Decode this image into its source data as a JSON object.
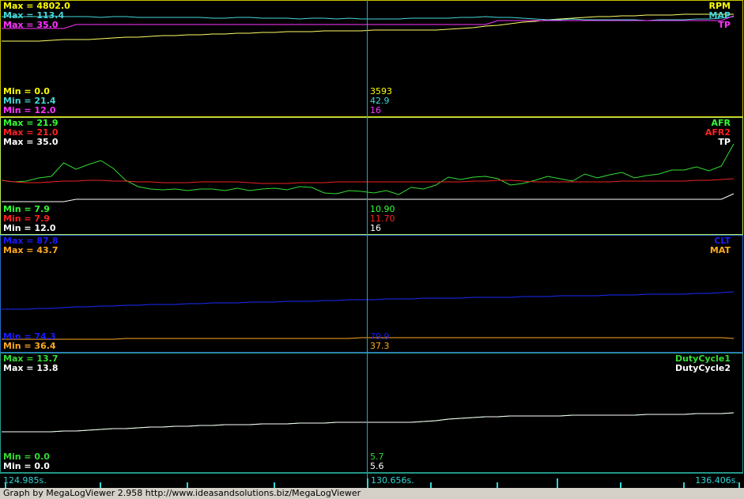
{
  "colors": {
    "background": "#000000",
    "cursor": "#2aa6b8",
    "axis": "#1a8c7c",
    "axis_text": "#2fd6d6",
    "footer_bg": "#d4d0c8"
  },
  "chart_data": [
    {
      "type": "line",
      "panel_border_color": "#c8c200",
      "x": [
        124.985,
        136.406
      ],
      "series": [
        {
          "name": "RPM",
          "color": "#ffff66",
          "legend_color": "#ffff00",
          "max": "Max = 4802.0",
          "min": "Min = 0.0",
          "cursor_value": "3593",
          "values": [
            52,
            52,
            52,
            52,
            51,
            50,
            50,
            50,
            49,
            48,
            47,
            47,
            46,
            45,
            45,
            44,
            44,
            43,
            43,
            42,
            42,
            41,
            41,
            40,
            40,
            40,
            39,
            39,
            39,
            39,
            38,
            38,
            38,
            38,
            38,
            38,
            37,
            36,
            35,
            33,
            32,
            30,
            28,
            27,
            25,
            24,
            23,
            22,
            21,
            21,
            20,
            20,
            19,
            19,
            19,
            18,
            18,
            18,
            18,
            18
          ]
        },
        {
          "name": "MAP",
          "color": "#44d8d8",
          "legend_color": "#44d8d8",
          "max": "Max = 113.4",
          "min": "Min = 21.4",
          "cursor_value": "42.9",
          "values": [
            21,
            21,
            21,
            21,
            20,
            21,
            21,
            21,
            22,
            21,
            21,
            22,
            22,
            22,
            22,
            22,
            22,
            23,
            23,
            22,
            22,
            23,
            23,
            23,
            24,
            23,
            23,
            24,
            23,
            24,
            24,
            24,
            24,
            23,
            23,
            23,
            23,
            22,
            22,
            21,
            22,
            22,
            23,
            24,
            25,
            25,
            24,
            25,
            25,
            25,
            25,
            25,
            26,
            25,
            25,
            25,
            24,
            24,
            23,
            21
          ]
        },
        {
          "name": "TP",
          "color": "#ff33ff",
          "legend_color": "#ff33ff",
          "max": "Max = 35.0",
          "min": "Min = 12.0",
          "cursor_value": "16",
          "values": [
            36,
            36,
            36,
            36,
            36,
            36,
            31,
            31,
            31,
            31,
            31,
            31,
            31,
            31,
            31,
            31,
            31,
            31,
            31,
            31,
            31,
            31,
            31,
            31,
            31,
            31,
            31,
            31,
            31,
            31,
            31,
            31,
            31,
            31,
            31,
            31,
            31,
            31,
            31,
            31,
            26,
            26,
            26,
            26,
            26,
            26,
            26,
            26,
            26,
            26,
            26,
            26,
            26,
            26,
            26,
            26,
            26,
            26,
            26,
            20
          ]
        }
      ]
    },
    {
      "type": "line",
      "panel_border_color": "#b8e860",
      "x": [
        124.985,
        136.406
      ],
      "series": [
        {
          "name": "AFR",
          "color": "#33dd33",
          "legend_color": "#33ff33",
          "max": "Max = 21.9",
          "min": "Min = 7.9",
          "cursor_value": "10.90",
          "values": [
            80,
            82,
            81,
            77,
            75,
            58,
            66,
            60,
            55,
            65,
            80,
            88,
            91,
            92,
            91,
            93,
            91,
            91,
            93,
            90,
            93,
            91,
            90,
            92,
            88,
            89,
            96,
            97,
            93,
            94,
            96,
            93,
            98,
            89,
            91,
            86,
            76,
            79,
            76,
            75,
            78,
            86,
            84,
            80,
            75,
            78,
            81,
            72,
            77,
            73,
            70,
            77,
            74,
            72,
            67,
            67,
            63,
            68,
            62,
            34
          ]
        },
        {
          "name": "AFR2",
          "color": "#ee2222",
          "legend_color": "#ff2222",
          "max": "Max = 21.0",
          "min": "Min = 7.9",
          "cursor_value": "11.70",
          "values": [
            80,
            82,
            83,
            83,
            82,
            81,
            81,
            80,
            80,
            81,
            81,
            82,
            82,
            83,
            83,
            83,
            82,
            82,
            82,
            82,
            83,
            84,
            84,
            84,
            83,
            83,
            83,
            82,
            82,
            82,
            82,
            82,
            82,
            82,
            82,
            82,
            82,
            82,
            81,
            81,
            80,
            80,
            81,
            82,
            82,
            82,
            82,
            82,
            82,
            82,
            81,
            81,
            81,
            81,
            81,
            81,
            80,
            80,
            79,
            78
          ]
        },
        {
          "name": "TP",
          "color": "#ffffff",
          "legend_color": "#ffffff",
          "max": "Max = 35.0",
          "min": "Min = 12.0",
          "cursor_value": "16",
          "values": [
            107,
            107,
            107,
            107,
            107,
            107,
            104,
            104,
            104,
            104,
            104,
            104,
            104,
            104,
            104,
            104,
            104,
            104,
            104,
            104,
            104,
            104,
            104,
            104,
            104,
            104,
            104,
            104,
            104,
            104,
            104,
            104,
            104,
            104,
            104,
            104,
            104,
            104,
            104,
            104,
            104,
            104,
            104,
            104,
            104,
            104,
            104,
            104,
            104,
            104,
            104,
            104,
            104,
            104,
            104,
            104,
            104,
            104,
            104,
            97
          ]
        }
      ]
    },
    {
      "type": "line",
      "panel_border_color": "#2a6ec8",
      "x": [
        124.985,
        136.406
      ],
      "series": [
        {
          "name": "CLT",
          "color": "#1a2bff",
          "legend_color": "#1a1aff",
          "max": "Max = 87.8",
          "min": "Min = 74.3",
          "cursor_value": "79.9",
          "values": [
            94,
            94,
            94,
            93,
            93,
            92,
            91,
            91,
            90,
            90,
            89,
            89,
            88,
            88,
            88,
            87,
            87,
            86,
            86,
            86,
            85,
            85,
            85,
            84,
            84,
            84,
            83,
            83,
            82,
            82,
            82,
            81,
            81,
            81,
            80,
            80,
            80,
            80,
            79,
            79,
            79,
            79,
            78,
            78,
            78,
            77,
            77,
            77,
            77,
            76,
            76,
            76,
            75,
            75,
            75,
            75,
            74,
            74,
            73,
            72
          ]
        },
        {
          "name": "MAT",
          "color": "#ffaa22",
          "legend_color": "#ffaa22",
          "max": "Max = 43.7",
          "min": "Min = 36.4",
          "cursor_value": "37.3",
          "values": [
            132,
            132,
            132,
            132,
            132,
            132,
            132,
            132,
            132,
            132,
            131,
            131,
            131,
            131,
            131,
            131,
            131,
            131,
            131,
            131,
            131,
            131,
            131,
            131,
            131,
            131,
            131,
            131,
            131,
            130,
            130,
            130,
            130,
            130,
            130,
            130,
            130,
            130,
            130,
            130,
            130,
            130,
            130,
            130,
            130,
            130,
            130,
            130,
            130,
            130,
            130,
            130,
            130,
            130,
            130,
            130,
            130,
            130,
            130,
            131
          ]
        }
      ]
    },
    {
      "type": "line",
      "panel_border_color": "#2a9c8c",
      "x": [
        124.985,
        136.406
      ],
      "series": [
        {
          "name": "DutyCycle1",
          "color": "#33cc33",
          "legend_color": "#33dd33",
          "max": "Max = 13.7",
          "min": "Min = 0.0",
          "cursor_value": "5.7",
          "values": [
            100,
            100,
            100,
            100,
            100,
            99,
            99,
            98,
            97,
            96,
            96,
            95,
            94,
            94,
            93,
            93,
            92,
            92,
            91,
            91,
            91,
            90,
            90,
            90,
            89,
            89,
            89,
            88,
            88,
            88,
            88,
            88,
            88,
            88,
            87,
            86,
            84,
            83,
            82,
            81,
            81,
            80,
            80,
            80,
            80,
            80,
            79,
            79,
            79,
            79,
            79,
            79,
            78,
            78,
            78,
            78,
            77,
            77,
            77,
            76
          ]
        },
        {
          "name": "DutyCycle2",
          "color": "#ffffff",
          "legend_color": "#ffffff",
          "max": "Max = 13.8",
          "min": "Min = 0.0",
          "cursor_value": "5.6",
          "values": [
            100,
            100,
            100,
            100,
            100,
            99,
            99,
            98,
            97,
            96,
            96,
            95,
            94,
            94,
            93,
            93,
            92,
            92,
            91,
            91,
            91,
            90,
            90,
            90,
            89,
            89,
            89,
            88,
            88,
            88,
            88,
            88,
            88,
            88,
            87,
            86,
            84,
            83,
            82,
            81,
            81,
            80,
            80,
            80,
            80,
            80,
            79,
            79,
            79,
            79,
            79,
            79,
            78,
            78,
            78,
            78,
            77,
            77,
            77,
            76
          ]
        }
      ]
    }
  ],
  "cursor_time": "130.656s.",
  "axis_start": "124.985s.",
  "axis_end": "136.406s.",
  "footer": "Graph by MegaLogViewer 2.958 http://www.ideasandsolutions.biz/MegaLogViewer"
}
